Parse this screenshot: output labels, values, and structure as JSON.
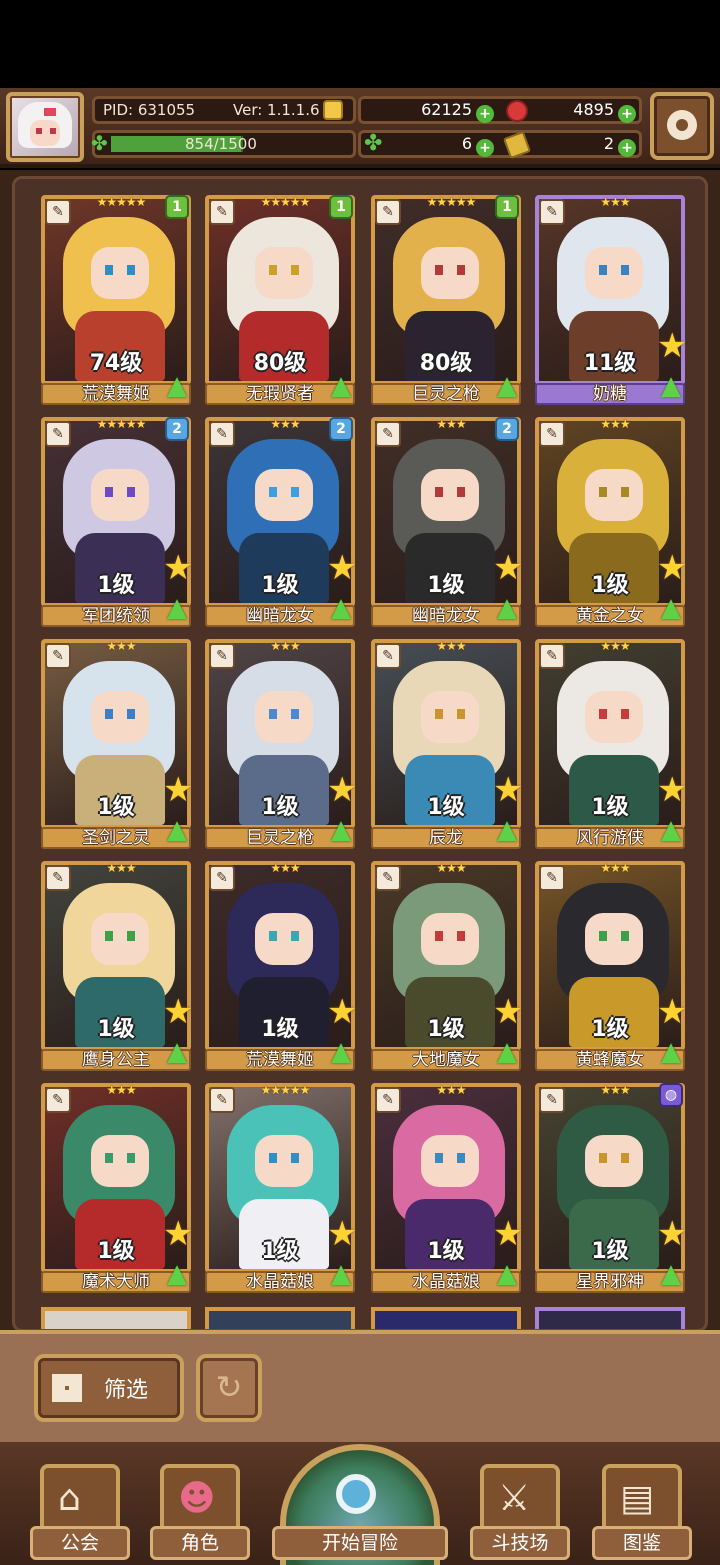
{
  "header": {
    "pid": "PID: 631055",
    "version": "Ver: 1.1.1.6",
    "xp": "854/1500",
    "xp_fraction": 0.569,
    "gold": "62125",
    "gems": "4895",
    "clover": "6",
    "tickets": "2"
  },
  "characters": [
    {
      "name": "荒漠舞姬",
      "level": "74级",
      "stars": "★★★★★",
      "badge": "1",
      "badge_color": "green",
      "frame": "gold",
      "colors": {
        "hair": "#f0c04e",
        "body": "#b8402d",
        "eye": "#2a8fc4"
      }
    },
    {
      "name": "无瑕贤者",
      "level": "80级",
      "stars": "★★★★★",
      "badge": "1",
      "badge_color": "green",
      "frame": "gold",
      "colors": {
        "hair": "#ece6dc",
        "body": "#b42b2b",
        "eye": "#c9a12b"
      }
    },
    {
      "name": "巨灵之枪",
      "level": "80级",
      "stars": "★★★★★",
      "badge": "1",
      "badge_color": "green",
      "frame": "gold",
      "colors": {
        "hair": "#e3b14b",
        "body": "#2b2430",
        "eye": "#b23a3a"
      }
    },
    {
      "name": "奶糖",
      "level": "11级",
      "stars": "★★★",
      "badge": "",
      "badge_color": "",
      "frame": "purple",
      "colors": {
        "hair": "#dfe6ee",
        "body": "#6d3e2a",
        "eye": "#3a83c2"
      }
    },
    {
      "name": "军团统领",
      "level": "1级",
      "stars": "★★★★★",
      "badge": "2",
      "badge_color": "blue",
      "frame": "gold",
      "colors": {
        "hair": "#cfc8e2",
        "body": "#3b2f55",
        "eye": "#6b4bc2"
      }
    },
    {
      "name": "幽暗龙女",
      "level": "1级",
      "stars": "★★★",
      "badge": "2",
      "badge_color": "blue",
      "frame": "gold",
      "colors": {
        "hair": "#2f6fb5",
        "body": "#1f3b5c",
        "eye": "#3b9fe0"
      }
    },
    {
      "name": "幽暗龙女",
      "level": "1级",
      "stars": "★★★",
      "badge": "2",
      "badge_color": "blue",
      "frame": "gold",
      "colors": {
        "hair": "#5a5a56",
        "body": "#2a2a2a",
        "eye": "#b23a3a"
      }
    },
    {
      "name": "黄金之女",
      "level": "1级",
      "stars": "★★★",
      "badge": "",
      "badge_color": "",
      "frame": "gold",
      "colors": {
        "hair": "#d8b03a",
        "body": "#8a6a1c",
        "eye": "#a88a24"
      }
    },
    {
      "name": "圣剑之灵",
      "level": "1级",
      "stars": "★★★",
      "badge": "",
      "badge_color": "",
      "frame": "gold",
      "colors": {
        "hair": "#d6e2ec",
        "body": "#c9b07a",
        "eye": "#3b7fc9"
      }
    },
    {
      "name": "巨灵之枪",
      "level": "1级",
      "stars": "★★★",
      "badge": "",
      "badge_color": "",
      "frame": "gold",
      "colors": {
        "hair": "#d7dde6",
        "body": "#5a6c8a",
        "eye": "#4a8ad4"
      }
    },
    {
      "name": "辰龙",
      "level": "1级",
      "stars": "★★★",
      "badge": "",
      "badge_color": "",
      "frame": "gold",
      "colors": {
        "hair": "#e8d8b8",
        "body": "#3a8ab5",
        "eye": "#c9942b"
      }
    },
    {
      "name": "风行游侠",
      "level": "1级",
      "stars": "★★★",
      "badge": "",
      "badge_color": "",
      "frame": "gold",
      "colors": {
        "hair": "#ece8e4",
        "body": "#2d5a48",
        "eye": "#c93a3a"
      }
    },
    {
      "name": "鹰身公主",
      "level": "1级",
      "stars": "★★★",
      "badge": "",
      "badge_color": "",
      "frame": "gold",
      "colors": {
        "hair": "#f0d69a",
        "body": "#2f6a6a",
        "eye": "#3fa04a"
      }
    },
    {
      "name": "荒漠舞姬",
      "level": "1级",
      "stars": "★★★",
      "badge": "",
      "badge_color": "",
      "frame": "gold",
      "colors": {
        "hair": "#2d2a5a",
        "body": "#1f1f2f",
        "eye": "#3aa7b5"
      }
    },
    {
      "name": "大地魔女",
      "level": "1级",
      "stars": "★★★",
      "badge": "",
      "badge_color": "",
      "frame": "gold",
      "colors": {
        "hair": "#7a9a7a",
        "body": "#4a4a2c",
        "eye": "#c23a3a"
      }
    },
    {
      "name": "黄蜂魔女",
      "level": "1级",
      "stars": "★★★",
      "badge": "",
      "badge_color": "",
      "frame": "gold",
      "colors": {
        "hair": "#2a2a2e",
        "body": "#c99a2a",
        "eye": "#3aa04a"
      }
    },
    {
      "name": "魔术大师",
      "level": "1级",
      "stars": "★★★",
      "badge": "",
      "badge_color": "",
      "frame": "gold",
      "colors": {
        "hair": "#3a8a6a",
        "body": "#b52a2a",
        "eye": "#3b9a6a"
      }
    },
    {
      "name": "水晶菇娘",
      "level": "1级",
      "stars": "★★★★★",
      "badge": "",
      "badge_color": "",
      "frame": "gold",
      "colors": {
        "hair": "#4ac2b8",
        "body": "#f0f0f4",
        "eye": "#2f8fc9"
      }
    },
    {
      "name": "水晶菇娘",
      "level": "1级",
      "stars": "★★★",
      "badge": "",
      "badge_color": "",
      "frame": "gold",
      "colors": {
        "hair": "#d96aa2",
        "body": "#4a2a6a",
        "eye": "#3a8ac2"
      }
    },
    {
      "name": "星界邪神",
      "level": "1级",
      "stars": "★★★",
      "badge": "",
      "badge_color": "purple",
      "frame": "gold",
      "colors": {
        "hair": "#2f5a44",
        "body": "#3a6a4a",
        "eye": "#c9942b"
      }
    }
  ],
  "filter": {
    "label": "筛选"
  },
  "nav": {
    "guild": "公会",
    "characters": "角色",
    "adventure": "开始冒险",
    "arena": "斗技场",
    "codex": "图鉴"
  }
}
